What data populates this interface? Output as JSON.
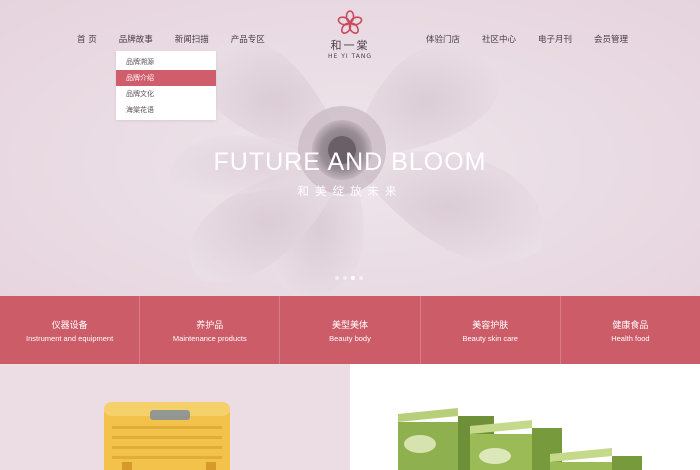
{
  "nav": {
    "left": [
      "首 页",
      "品牌故事",
      "新闻扫描",
      "产品专区"
    ],
    "right": [
      "体验门店",
      "社区中心",
      "电子月刊",
      "会员管理"
    ]
  },
  "logo": {
    "cn": "和一棠",
    "en": "HE YI TANG",
    "icon": "flower-logo-icon"
  },
  "dropdown": {
    "items": [
      "品牌溯源",
      "品牌介绍",
      "品牌文化",
      "海棠花语"
    ],
    "active_index": 1
  },
  "hero": {
    "title": "FUTURE AND BLOOM",
    "subtitle": "和美绽放未来",
    "slides": 4,
    "active_slide": 2
  },
  "categories": [
    {
      "cn": "仪器设备",
      "en": "Instrument and equipment"
    },
    {
      "cn": "养护品",
      "en": "Maintenance products"
    },
    {
      "cn": "美型美体",
      "en": "Beauty body"
    },
    {
      "cn": "美容护肤",
      "en": "Beauty skin care"
    },
    {
      "cn": "健康食品",
      "en": "Health food"
    }
  ],
  "colors": {
    "accent": "#cc5c68",
    "hero_bg": "#eadde5",
    "text": "#4a3f46"
  }
}
